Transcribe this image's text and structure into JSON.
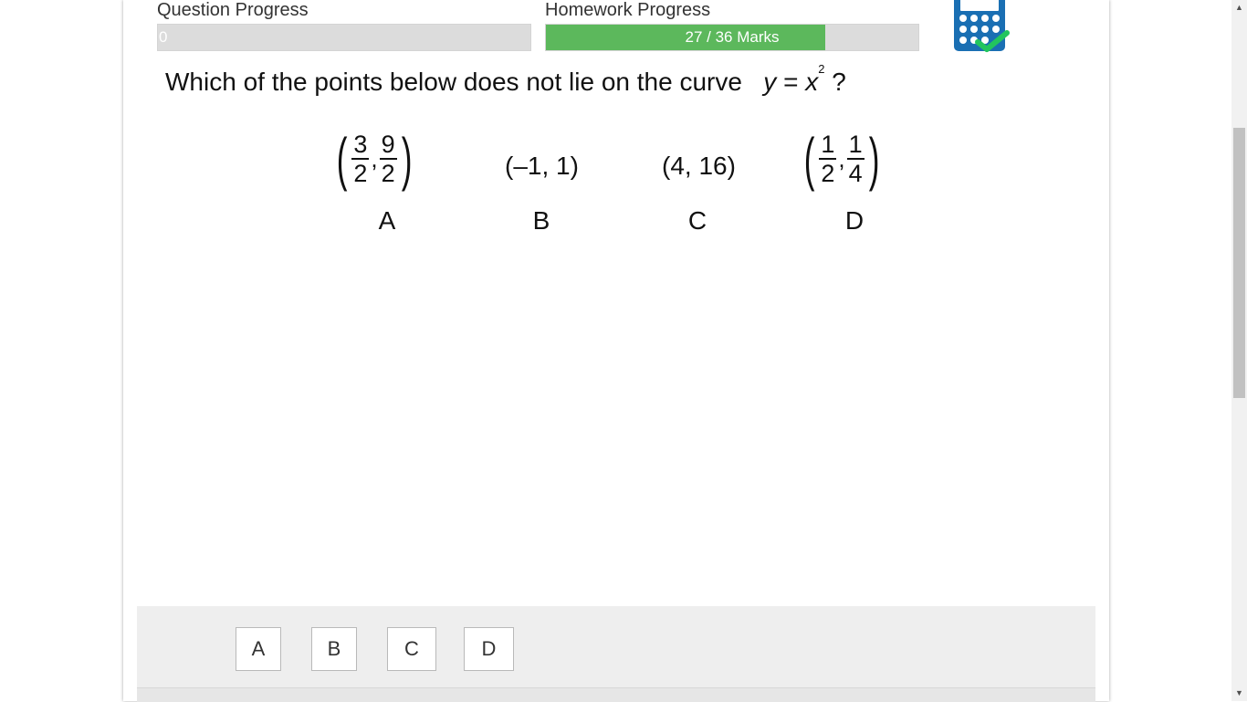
{
  "progress": {
    "question_label": "Question Progress",
    "question_value": "0",
    "homework_label": "Homework Progress",
    "homework_text": "27 / 36 Marks",
    "homework_marks": 27,
    "homework_total": 36,
    "question_fraction": 0
  },
  "question": {
    "text": "Which of the points below does not lie on the curve",
    "equation_lhs": "y",
    "equation_eq": "=",
    "equation_rhs": "x",
    "equation_exp": "2",
    "question_mark": "?"
  },
  "options": [
    {
      "letter": "A",
      "num1": "3",
      "den1": "2",
      "num2": "9",
      "den2": "2"
    },
    {
      "letter": "B",
      "point": "(–1, 1)"
    },
    {
      "letter": "C",
      "point": "(4, 16)"
    },
    {
      "letter": "D",
      "num1": "1",
      "den1": "2",
      "num2": "1",
      "den2": "4"
    }
  ],
  "answers": [
    "A",
    "B",
    "C",
    "D"
  ],
  "colors": {
    "progress_fill": "#5cb85c",
    "progress_track": "#dcdcdc",
    "calculator": "#1a6fb3",
    "check": "#22c55e"
  },
  "icons": {
    "calculator": "calculator-allowed-icon"
  }
}
